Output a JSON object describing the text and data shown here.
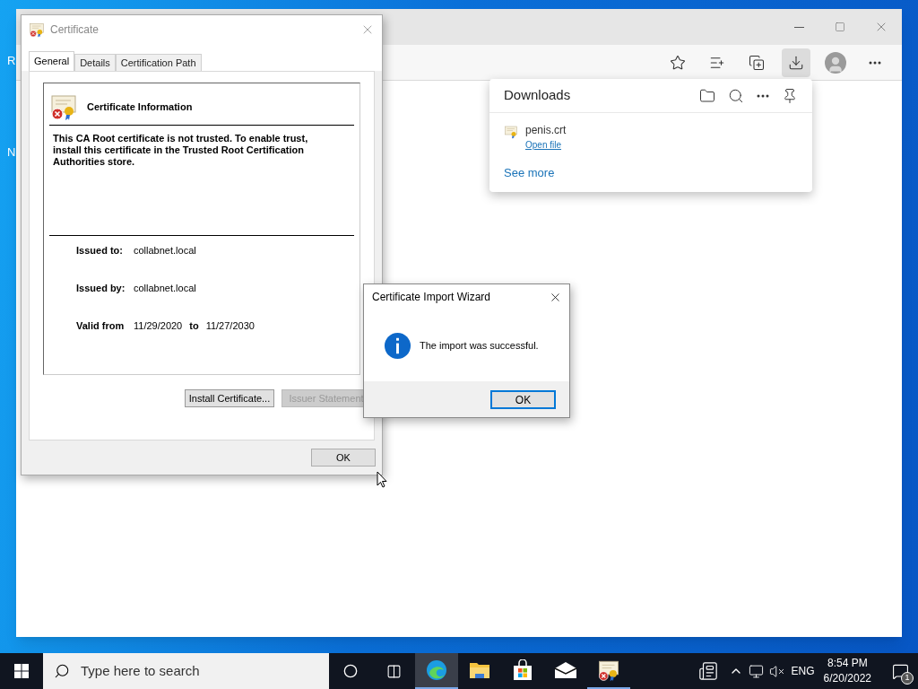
{
  "desktop": {
    "icon_labels": [
      "R",
      "N"
    ]
  },
  "browser": {
    "toolbar": [
      {
        "kind": "favorite-add",
        "selected": false
      },
      {
        "kind": "favorites",
        "selected": false
      },
      {
        "kind": "collections",
        "selected": false
      },
      {
        "kind": "downloads",
        "selected": true
      },
      {
        "kind": "profile",
        "selected": false
      },
      {
        "kind": "more",
        "selected": false
      }
    ]
  },
  "downloads_panel": {
    "title": "Downloads",
    "items": [
      {
        "name": "penis.crt",
        "action": "Open file"
      }
    ],
    "see_more": "See more"
  },
  "certificate_dialog": {
    "title": "Certificate",
    "tabs": [
      {
        "label": "General",
        "selected": true
      },
      {
        "label": "Details",
        "selected": false
      },
      {
        "label": "Certification Path",
        "selected": false
      }
    ],
    "heading": "Certificate Information",
    "message": "This CA Root certificate is not trusted. To enable trust, install this certificate in the Trusted Root Certification Authorities store.",
    "fields": [
      {
        "label": "Issued to:",
        "value": "collabnet.local"
      },
      {
        "label": "Issued by:",
        "value": "collabnet.local"
      }
    ],
    "validity": {
      "label": "Valid from",
      "from": "11/29/2020",
      "to_label": "to",
      "to": "11/27/2030"
    },
    "buttons": [
      {
        "label": "Install Certificate...",
        "disabled": false
      },
      {
        "label": "Issuer Statement",
        "disabled": true
      }
    ],
    "ok": "OK"
  },
  "wizard": {
    "title": "Certificate Import Wizard",
    "message": "The import was successful.",
    "ok": "OK"
  },
  "taskbar": {
    "search_placeholder": "Type here to search",
    "apps": [
      {
        "kind": "edge",
        "active": true,
        "open": true
      },
      {
        "kind": "explorer",
        "active": false,
        "open": false
      },
      {
        "kind": "store",
        "active": false,
        "open": false
      },
      {
        "kind": "mail",
        "active": false,
        "open": false
      },
      {
        "kind": "certificate",
        "active": false,
        "open": true
      }
    ],
    "language": "ENG",
    "time": "8:54 PM",
    "date": "6/20/2022",
    "notification_count": "1"
  }
}
